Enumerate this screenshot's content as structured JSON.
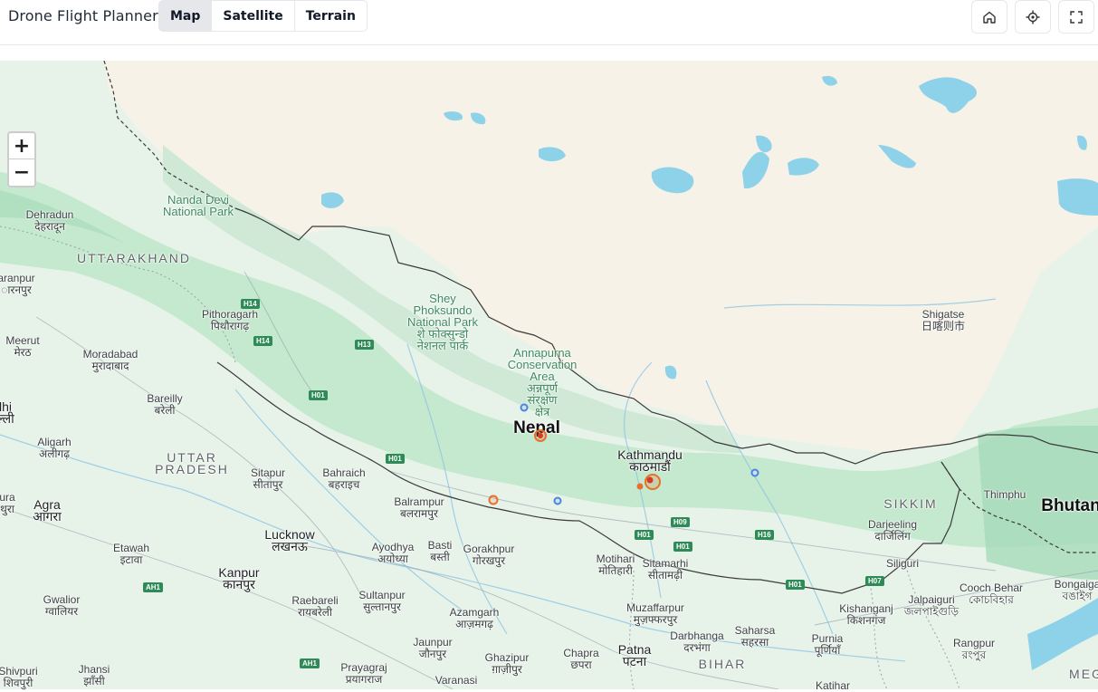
{
  "app": {
    "title": "Drone Flight Planner"
  },
  "map_types": {
    "map": "Map",
    "satellite": "Satellite",
    "terrain": "Terrain",
    "active": "Map"
  },
  "toolbar": {
    "home_icon": "home-icon",
    "locate_icon": "crosshair-icon",
    "fullscreen_icon": "fullscreen-icon"
  },
  "zoom": {
    "in": "+",
    "out": "−"
  },
  "labels": {
    "nanda_devi": "Nanda Devi\nNational Park",
    "dehradun": "Dehradun\nदेहरादून",
    "uttarakhand": "UTTARAKHAND",
    "saharanpur": "aranpur\nारनपुर",
    "pithoragarh": "Pithoragarh\nपिथौरागढ़",
    "meerut": "Meerut\nमेरठ",
    "moradabad": "Moradabad\nमुरादाबाद",
    "bareilly": "Bareilly\nबरेली",
    "delhi": "lhi\nल्ली",
    "aligarh": "Aligarh\nअलीगढ़",
    "uttar_pradesh": "UTTAR\nPRADESH",
    "sitapur": "Sitapur\nसीतापुर",
    "bahraich": "Bahraich\nबहराइच",
    "agra": "Agra\nआगरा",
    "mathura": "ura\nथुरा",
    "lucknow": "Lucknow\nलखनऊ",
    "etawah": "Etawah\nइटावा",
    "kanpur": "Kanpur\nकानपुर",
    "gwalior": "Gwalior\nग्वालियर",
    "raebareli": "Raebareli\nरायबरेली",
    "sultanpur": "Sultanpur\nसुल्तानपुर",
    "ayodhya": "Ayodhya\nअयोध्या",
    "basti": "Basti\nबस्ती",
    "gorakhpur": "Gorakhpur\nगोरखपुर",
    "azamgarh": "Azamgarh\nआज़मगढ़",
    "jaunpur": "Jaunpur\nजौनपुर",
    "ghazipur": "Ghazipur\nग़ाज़ीपुर",
    "varanasi": "Varanasi",
    "prayagraj": "Prayagraj\nप्रयागराज",
    "jhansi": "Jhansi\nझाँसी",
    "shivpuri": "Shivpuri\nशिवपुरी",
    "balrampur": "Balrampur\nबलरामपुर",
    "shey_phoksundo": "Shey\nPhoksundo\nNational Park\nशे फोक्सुन्डो\nनेशनल पार्क",
    "annapurna": "Annapurna\nConservation\nArea\nअन्नपूर्ण\nसंरक्षण\nक्षेत्र",
    "nepal": "Nepal",
    "kathmandu": "Kathmandu\nकाठमाडौं",
    "motihari": "Motihari\nमोतिहारी",
    "sitamarhi": "Sitamarhi\nसीतामढ़ी",
    "muzaffarpur": "Muzaffarpur\nमुज़फ्फरपुर",
    "darbhanga": "Darbhanga\nदरभंगा",
    "saharsa": "Saharsa\nसहरसा",
    "purnia": "Purnia\nपूर्णियाँ",
    "chapra": "Chapra\nछपरा",
    "patna": "Patna\nपटना",
    "bihar": "BIHAR",
    "kishanganj": "Kishanganj\nकिशनगंज",
    "katihar": "Katihar",
    "sikkim": "SIKKIM",
    "darjeeling": "Darjeeling\nदार्जिलिंग",
    "siliguri": "Siliguri",
    "jalpaiguri": "Jalpaiguri\nজলপাইগুড়ি",
    "cooch_behar": "Cooch Behar\nকোচবিহার",
    "bongaigaon": "Bongaiga\nবঙাইগ",
    "rangpur": "Rangpur\nরংপুর",
    "thimphu": "Thimphu",
    "bhutan": "Bhutan",
    "shigatse": "Shigatse\n日喀则市",
    "meghalaya": "MEG"
  },
  "highways": [
    "H14",
    "H14",
    "H13",
    "H01",
    "H01",
    "H09",
    "H01",
    "H01",
    "H16",
    "H07",
    "H01",
    "AH1",
    "AH1"
  ],
  "colors": {
    "land": "#e8f2e6",
    "highland": "#f5f1e6",
    "forest": "#a9dbbc",
    "water": "#8ed2ea",
    "border": "#3a3a3a",
    "marker_orange": "#e8702a",
    "marker_blue": "#4a86d8"
  }
}
